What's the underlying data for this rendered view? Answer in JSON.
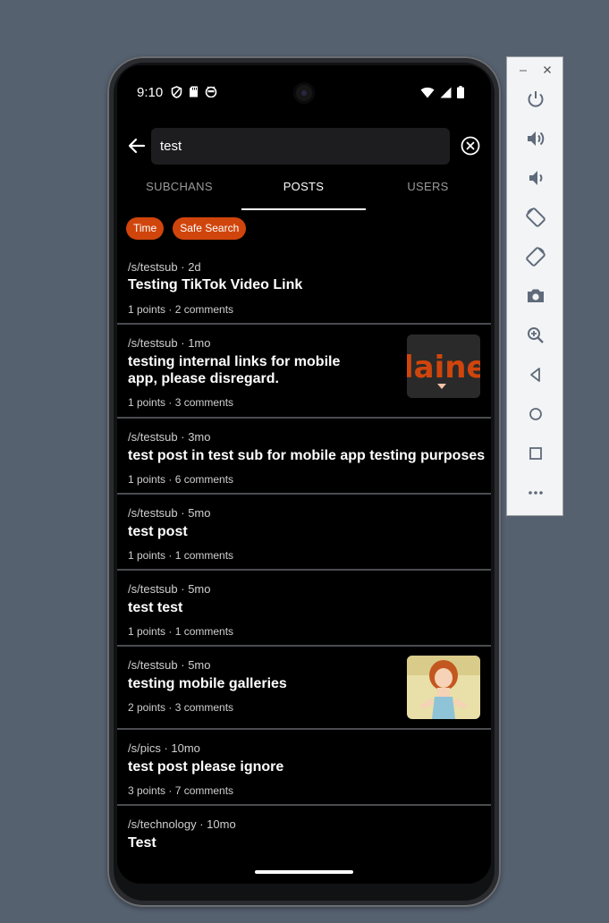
{
  "status_bar": {
    "time": "9:10"
  },
  "search": {
    "value": "test"
  },
  "tabs": [
    {
      "label": "SUBCHANS",
      "active": false
    },
    {
      "label": "POSTS",
      "active": true
    },
    {
      "label": "USERS",
      "active": false
    }
  ],
  "filters": [
    {
      "label": "Time"
    },
    {
      "label": "Safe Search"
    }
  ],
  "posts": [
    {
      "meta": "/s/testsub · 2d",
      "title": "Testing TikTok Video Link",
      "stats": "1 points · 2 comments"
    },
    {
      "meta": "/s/testsub · 1mo",
      "title": "testing internal links for mobile app, please disregard.",
      "stats": "1 points · 3 comments",
      "thumbnail_text": "laine"
    },
    {
      "meta": "/s/testsub · 3mo",
      "title": "test post in test sub for mobile app testing purposes",
      "stats": "1 points · 6 comments"
    },
    {
      "meta": "/s/testsub · 5mo",
      "title": "test post",
      "stats": "1 points · 1 comments"
    },
    {
      "meta": "/s/testsub · 5mo",
      "title": "test test",
      "stats": "1 points · 1 comments"
    },
    {
      "meta": "/s/testsub · 5mo",
      "title": "testing mobile galleries",
      "stats": "2 points · 3 comments"
    },
    {
      "meta": "/s/pics · 10mo",
      "title": "test post please ignore",
      "stats": "3 points · 7 comments"
    },
    {
      "meta": "/s/technology · 10mo",
      "title": "Test",
      "stats": ""
    }
  ],
  "colors": {
    "accent": "#d0450c",
    "background": "#000000",
    "desktop": "#566170"
  },
  "emulator_toolbar": {
    "buttons": [
      "power-icon",
      "volume-up-icon",
      "volume-down-icon",
      "rotate-left-icon",
      "rotate-right-icon",
      "camera-icon",
      "zoom-icon",
      "back-icon",
      "home-icon",
      "overview-icon",
      "more-icon"
    ]
  }
}
